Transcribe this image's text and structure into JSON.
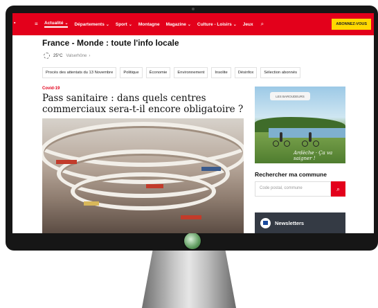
{
  "nav": {
    "items": [
      {
        "label": "Actualité",
        "has_chevron": true
      },
      {
        "label": "Départements",
        "has_chevron": true
      },
      {
        "label": "Sport",
        "has_chevron": true
      },
      {
        "label": "Montagne",
        "has_chevron": false
      },
      {
        "label": "Magazine",
        "has_chevron": true
      },
      {
        "label": "Culture - Loisirs",
        "has_chevron": true
      },
      {
        "label": "Jeux",
        "has_chevron": false
      }
    ],
    "subscribe_label": "ABONNEZ-VOUS",
    "accent_color": "#e3001b"
  },
  "page": {
    "headline": "France - Monde : toute l'info locale",
    "weather_temp": "25°C",
    "weather_town": "Valserhône"
  },
  "tags": [
    "Procès des attentats du 13 Novembre",
    "Politique",
    "Économie",
    "Environnement",
    "Insolite",
    "Désinfox",
    "Sélection abonnés"
  ],
  "article": {
    "kicker": "Covid-19",
    "title": "Pass sanitaire : dans quels centres commerciaux sera-t-il encore obligatoire ?"
  },
  "ad": {
    "sign_text": "LES BAROUDEURS",
    "slogan": "Ardèche · Ça va saigner !"
  },
  "commune_search": {
    "label": "Rechercher ma commune",
    "placeholder": "Code postal, commune"
  },
  "newsletter": {
    "label": "Newsletters"
  }
}
